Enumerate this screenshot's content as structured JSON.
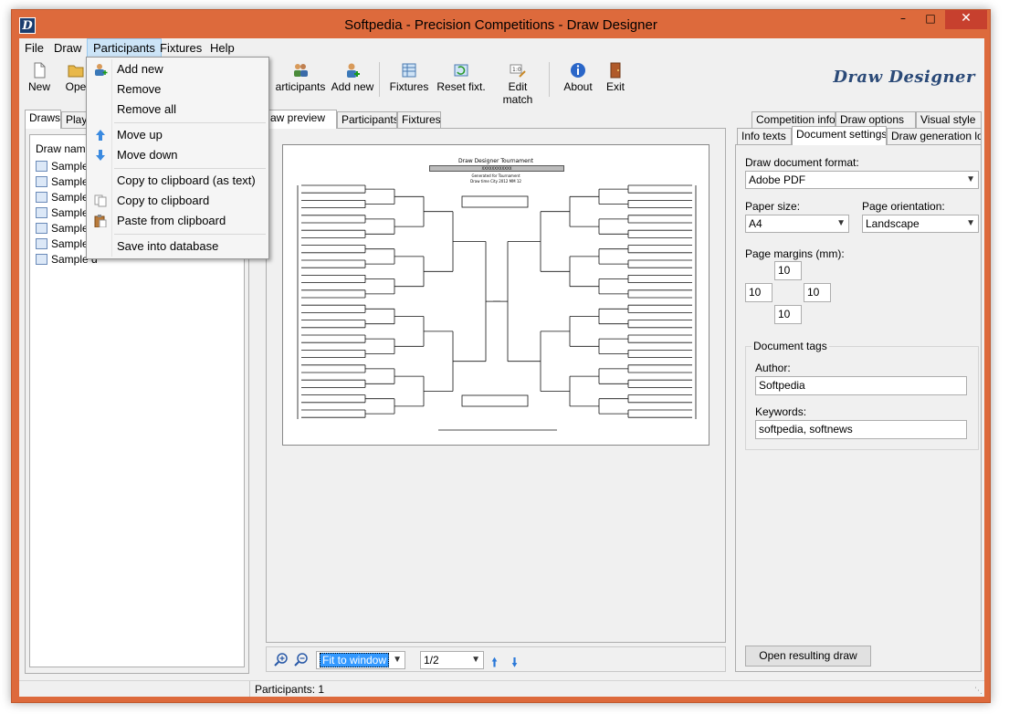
{
  "window": {
    "title": "Softpedia - Precision Competitions - Draw Designer",
    "app_icon": "D",
    "accent": "#dd6a3c"
  },
  "menubar": [
    "File",
    "Draw",
    "Participants",
    "Fixtures",
    "Help"
  ],
  "toolbar": {
    "new": "New",
    "open": "Ope",
    "participants": "articipants",
    "add_new": "Add new",
    "fixtures": "Fixtures",
    "reset_fixt": "Reset fixt.",
    "edit_match": "Edit match",
    "about": "About",
    "exit": "Exit",
    "brand": "Draw Designer"
  },
  "left_panel": {
    "tabs": [
      "Draws",
      "Play"
    ],
    "header": "Draw name",
    "items": [
      "Sample d",
      "Sample d",
      "Sample d",
      "Sample d",
      "Sample d",
      "Sample d",
      "Sample d"
    ]
  },
  "center_panel": {
    "tabs": [
      "aw preview",
      "Participants",
      "Fixtures"
    ],
    "sheet": {
      "title": "Draw Designer Tournament",
      "subtitle": "XXXXXXXXXXXX",
      "line1": "Generated for Tournament",
      "line2": "Draw time City 2012 MM 12"
    },
    "zoom": "Fit to window",
    "page": "1/2"
  },
  "right_panel": {
    "tabs_row1": [
      "Competition info",
      "Draw options",
      "Visual style"
    ],
    "tabs_row2": [
      "Info texts",
      "Document settings",
      "Draw generation log"
    ],
    "format_label": "Draw document format:",
    "format_value": "Adobe PDF",
    "paper_label": "Paper size:",
    "paper_value": "A4",
    "orientation_label": "Page orientation:",
    "orientation_value": "Landscape",
    "margins_label": "Page margins (mm):",
    "margins": {
      "top": "10",
      "left": "10",
      "right": "10",
      "bottom": "10"
    },
    "tags_label": "Document tags",
    "author_label": "Author:",
    "author_value": "Softpedia",
    "keywords_label": "Keywords:",
    "keywords_value": "softpedia, softnews",
    "open_button": "Open resulting draw"
  },
  "status": {
    "participants": "Participants: 1"
  },
  "popup_menu": {
    "add_new": "Add new",
    "remove": "Remove",
    "remove_all": "Remove all",
    "move_up": "Move up",
    "move_down": "Move down",
    "copy_text": "Copy to clipboard (as text)",
    "copy": "Copy to clipboard",
    "paste": "Paste from clipboard",
    "save_db": "Save into database"
  }
}
